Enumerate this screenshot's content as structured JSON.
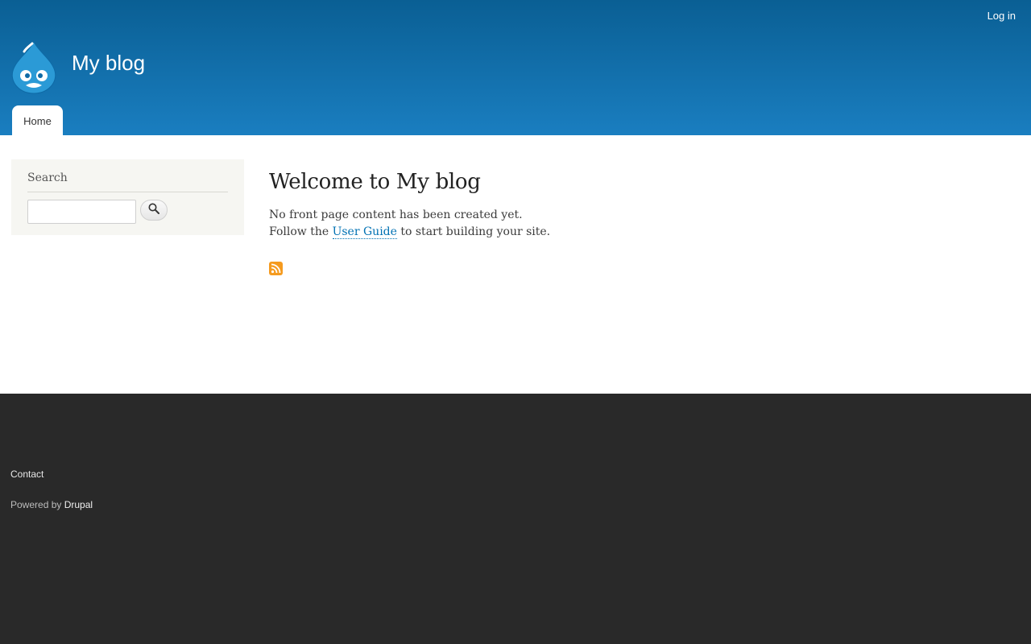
{
  "header": {
    "login_label": "Log in",
    "site_name": "My blog",
    "logo_icon": "drupal-drop-icon",
    "tabs": [
      {
        "label": "Home",
        "active": true
      }
    ]
  },
  "sidebar": {
    "search_block": {
      "title": "Search",
      "input_value": "",
      "button_icon": "search-icon"
    }
  },
  "content": {
    "title": "Welcome to My blog",
    "line1": "No front page content has been created yet.",
    "line2_prefix": "Follow the ",
    "line2_link": "User Guide",
    "line2_suffix": " to start building your site.",
    "feed_icon": "rss-feed-icon"
  },
  "footer": {
    "contact_label": "Contact",
    "powered_prefix": "Powered by ",
    "powered_link": "Drupal"
  },
  "colors": {
    "header_top": "#0a5f94",
    "header_bottom": "#1a7ec0",
    "link": "#0071b3",
    "footer_bg": "#292929",
    "rss": "#f59b1f"
  }
}
